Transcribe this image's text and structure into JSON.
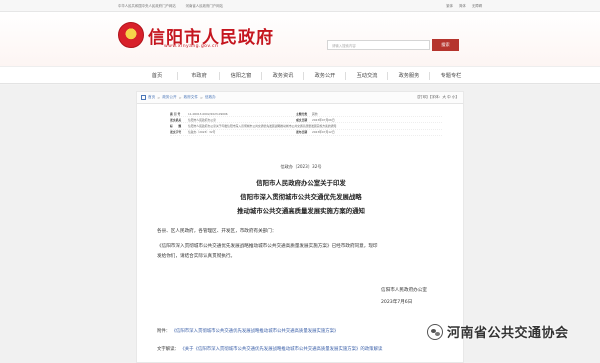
{
  "topbar": {
    "link1": "中华人民共和国中央人民政府门户网站",
    "link2": "河南省人民政府门户网站",
    "right1": "繁体",
    "right2": "简体",
    "right3": "无障碍"
  },
  "header": {
    "site_name": "信阳市人民政府",
    "site_url": "www.xinyang.gov.cn",
    "search_placeholder": "请输入搜索内容",
    "search_button": "搜索"
  },
  "nav": {
    "items": [
      "首页",
      "市政府",
      "信阳之窗",
      "政务资讯",
      "政务公开",
      "互动交流",
      "政务服务",
      "专题专栏"
    ]
  },
  "breadcrumb": {
    "items": [
      "首页",
      "政务公开",
      "政府文件",
      "信政办"
    ],
    "tools": "【打印】【字体：大 中 小】"
  },
  "meta": {
    "rows": [
      {
        "k": "索 引 号",
        "v": "11-00013-0002/2023-09006",
        "k2": "主题分类",
        "v2": "其他"
      },
      {
        "k": "发文机关",
        "v": "信阳市人民政府办公室",
        "k2": "成文日期",
        "v2": "2023年07月06日"
      },
      {
        "k": "标　　题",
        "v": "信阳市人民政府办公室关于印发信阳市深入贯彻城市公共交通优先发展战略推动城市公共交通高质量发展实施方案的通知",
        "k2": "",
        "v2": ""
      },
      {
        "k": "发文字号",
        "v": "信政办〔2023〕32号",
        "k2": "发布日期",
        "v2": "2023年07月12日"
      }
    ]
  },
  "document": {
    "doc_number": "信政办〔2023〕32号",
    "title_line1": "信阳市人民政府办公室关于印发",
    "title_line2": "信阳市深入贯彻城市公共交通优先发展战略",
    "title_line3": "推动城市公共交通高质量发展实施方案的通知",
    "salutation": "各县、区人民政府，各管理区、开发区，市政府有关部门：",
    "paragraph_1": "《信阳市深入贯彻城市公共交通优先发展战略推动城市公共交通高质量发展实施方案》已经市政府同意，现印",
    "paragraph_2": "发给你们，请结合实际认真贯彻执行。",
    "signer": "信阳市人民政府办公室",
    "sign_date": "2023年7月6日",
    "attachment_label": "附件：",
    "attachment_link": "《信阳市深入贯彻城市公共交通优先发展战略推动城市公共交通高质量发展实施方案》",
    "explain_label": "文字解读：",
    "explain_link": "《关于《信阳市深入贯彻城市公共交通优先发展战略推动城市公共交通高质量发展实施方案》的政策解读"
  },
  "watermark": {
    "text": "河南省公共交通协会"
  }
}
